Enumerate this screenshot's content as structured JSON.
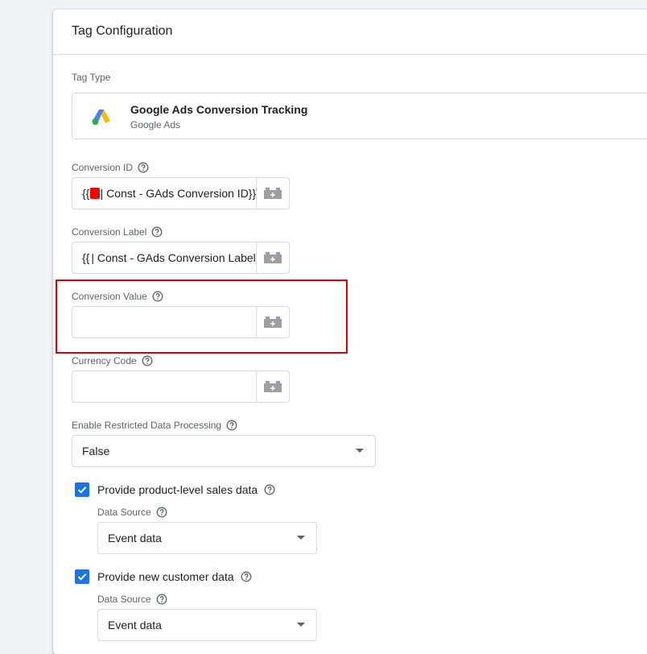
{
  "card": {
    "title": "Tag Configuration"
  },
  "tag_type": {
    "label": "Tag Type",
    "name": "Google Ads Conversion Tracking",
    "vendor": "Google Ads",
    "logo_icon": "google-ads-logo"
  },
  "fields": {
    "conversion_id": {
      "label": "Conversion ID",
      "value_prefix": "{{",
      "value_suffix": "| Const - GAds Conversion ID}}"
    },
    "conversion_label": {
      "label": "Conversion Label",
      "value_prefix": "{{",
      "value_suffix": "| Const - GAds Conversion Label}}"
    },
    "conversion_value": {
      "label": "Conversion Value",
      "value": ""
    },
    "currency_code": {
      "label": "Currency Code",
      "value": ""
    }
  },
  "restricted_data": {
    "label": "Enable Restricted Data Processing",
    "selected": "False"
  },
  "product_sales": {
    "checked": true,
    "label": "Provide product-level sales data",
    "source_label": "Data Source",
    "source_selected": "Event data"
  },
  "new_customer": {
    "checked": true,
    "label": "Provide new customer data",
    "source_label": "Data Source",
    "source_selected": "Event data"
  },
  "icons": {
    "help": "help-circle-icon",
    "variable": "variable-brick-icon",
    "dropdown": "caret-down-icon",
    "check": "checkmark-icon"
  },
  "colors": {
    "accent": "#1a73e8",
    "highlight": "#e00000",
    "redaction": "#ff0000"
  }
}
